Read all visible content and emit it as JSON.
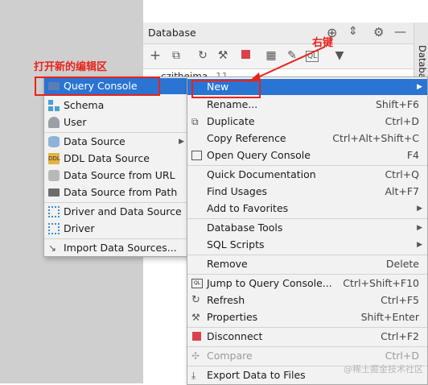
{
  "panel": {
    "title": "Database",
    "strip_label": "Database",
    "tree_node": "czitheima",
    "tree_count": "11"
  },
  "left_menu": {
    "items": [
      {
        "label": "Query Console",
        "icon": "query-console-icon",
        "submenu": false
      },
      {
        "label": "Schema",
        "icon": "schema-icon",
        "submenu": false
      },
      {
        "label": "User",
        "icon": "user-icon",
        "submenu": false
      },
      {
        "label": "Data Source",
        "icon": "database-icon",
        "submenu": true
      },
      {
        "label": "DDL Data Source",
        "icon": "ddl-icon",
        "submenu": false
      },
      {
        "label": "Data Source from URL",
        "icon": "url-icon",
        "submenu": false
      },
      {
        "label": "Data Source from Path",
        "icon": "folder-icon",
        "submenu": false
      },
      {
        "label": "Driver and Data Source",
        "icon": "driver-icon",
        "submenu": false
      },
      {
        "label": "Driver",
        "icon": "driver-icon",
        "submenu": false
      },
      {
        "label": "Import Data Sources...",
        "icon": "import-icon",
        "submenu": false
      }
    ]
  },
  "context_menu": {
    "items": [
      {
        "label": "New",
        "shortcut": "",
        "submenu": true
      },
      {
        "label": "Rename...",
        "shortcut": "Shift+F6",
        "submenu": false
      },
      {
        "label": "Duplicate",
        "shortcut": "Ctrl+D",
        "submenu": false
      },
      {
        "label": "Copy Reference",
        "shortcut": "Ctrl+Alt+Shift+C",
        "submenu": false
      },
      {
        "label": "Open Query Console",
        "shortcut": "F4",
        "submenu": false
      },
      {
        "label": "Quick Documentation",
        "shortcut": "Ctrl+Q",
        "submenu": false
      },
      {
        "label": "Find Usages",
        "shortcut": "Alt+F7",
        "submenu": false
      },
      {
        "label": "Add to Favorites",
        "shortcut": "",
        "submenu": true
      },
      {
        "label": "Database Tools",
        "shortcut": "",
        "submenu": true
      },
      {
        "label": "SQL Scripts",
        "shortcut": "",
        "submenu": true
      },
      {
        "label": "Remove",
        "shortcut": "Delete",
        "submenu": false
      },
      {
        "label": "Jump to Query Console...",
        "shortcut": "Ctrl+Shift+F10",
        "submenu": false
      },
      {
        "label": "Refresh",
        "shortcut": "Ctrl+F5",
        "submenu": false
      },
      {
        "label": "Properties",
        "shortcut": "Shift+Enter",
        "submenu": false
      },
      {
        "label": "Disconnect",
        "shortcut": "Ctrl+F2",
        "submenu": false
      },
      {
        "label": "Compare",
        "shortcut": "Ctrl+D",
        "submenu": false,
        "disabled": true
      },
      {
        "label": "Export Data to Files",
        "shortcut": "",
        "submenu": false
      }
    ]
  },
  "annotations": {
    "left_note": "打开新的编辑区",
    "right_note": "右键",
    "watermark": "@稀土掘金技术社区"
  },
  "colors": {
    "selection": "#2a74d4",
    "annotation_red": "#e8231b",
    "disconnect_red": "#d9434b"
  }
}
